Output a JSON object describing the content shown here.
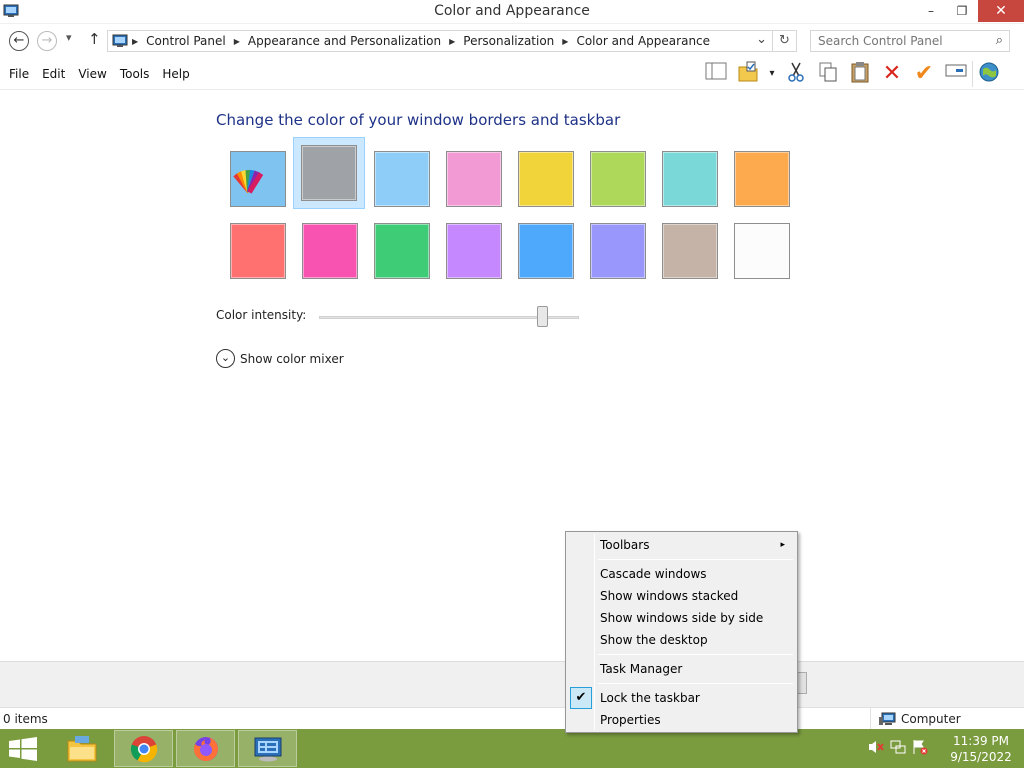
{
  "window": {
    "title": "Color and Appearance",
    "minimize": "–",
    "restore": "❐",
    "close": "✕"
  },
  "nav": {
    "back": "←",
    "forward": "→",
    "recent": "▾",
    "up": "↑"
  },
  "address": {
    "crumbs": [
      "Control Panel",
      "Appearance and Personalization",
      "Personalization",
      "Color and Appearance"
    ],
    "dropdown": "⌄",
    "refresh": "↻"
  },
  "search": {
    "placeholder": "Search Control Panel",
    "icon": "⌕"
  },
  "menu": {
    "items": [
      "File",
      "Edit",
      "View",
      "Tools",
      "Help"
    ]
  },
  "toolbar": {
    "icons": [
      "layout-icon",
      "properties-icon",
      "dropdown-icon",
      "cut-icon",
      "copy-icon",
      "paste-icon",
      "delete-icon",
      "check-icon",
      "rename-icon",
      "globe-icon"
    ]
  },
  "main": {
    "heading": "Change the color of your window borders and taskbar",
    "swatches": [
      {
        "name": "automatic",
        "color": "#7fc4f0"
      },
      {
        "name": "sky",
        "color": "#9fa2a6",
        "selected": true
      },
      {
        "name": "twilight",
        "color": "#8ecdf8"
      },
      {
        "name": "blush",
        "color": "#f29ad4"
      },
      {
        "name": "sun",
        "color": "#f0d43a"
      },
      {
        "name": "leaf",
        "color": "#aed859"
      },
      {
        "name": "lime",
        "color": "#7ad9d8"
      },
      {
        "name": "pumpkin",
        "color": "#fdaa4f"
      },
      {
        "name": "fuchsia",
        "color": "#ff7171"
      },
      {
        "name": "pink",
        "color": "#f853b0"
      },
      {
        "name": "sea",
        "color": "#3fcc77"
      },
      {
        "name": "violet",
        "color": "#c688fe"
      },
      {
        "name": "lagoon",
        "color": "#4ea8fb"
      },
      {
        "name": "lavender",
        "color": "#9a97fc"
      },
      {
        "name": "taupe",
        "color": "#c4b3a6"
      },
      {
        "name": "frost",
        "color": "#fcfcfc"
      }
    ],
    "intensity_label": "Color intensity:",
    "mixer_label": "Show color mixer",
    "mixer_icon": "⌄"
  },
  "status": {
    "items": "0 items",
    "zone": "Computer"
  },
  "context_menu": {
    "items": [
      {
        "label": "Toolbars",
        "submenu": "▸"
      },
      {
        "label": "Cascade windows"
      },
      {
        "label": "Show windows stacked"
      },
      {
        "label": "Show windows side by side"
      },
      {
        "label": "Show the desktop"
      },
      {
        "label": "Task Manager"
      },
      {
        "label": "Lock the taskbar",
        "check": "✔"
      },
      {
        "label": "Properties"
      }
    ]
  },
  "taskbar": {
    "apps": [
      "file-explorer-icon",
      "chrome-icon",
      "firefox-icon",
      "control-panel-icon"
    ],
    "tray": [
      "volume-muted-icon",
      "network-icon",
      "action-center-icon"
    ],
    "time": "11:39 PM",
    "date": "9/15/2022"
  }
}
